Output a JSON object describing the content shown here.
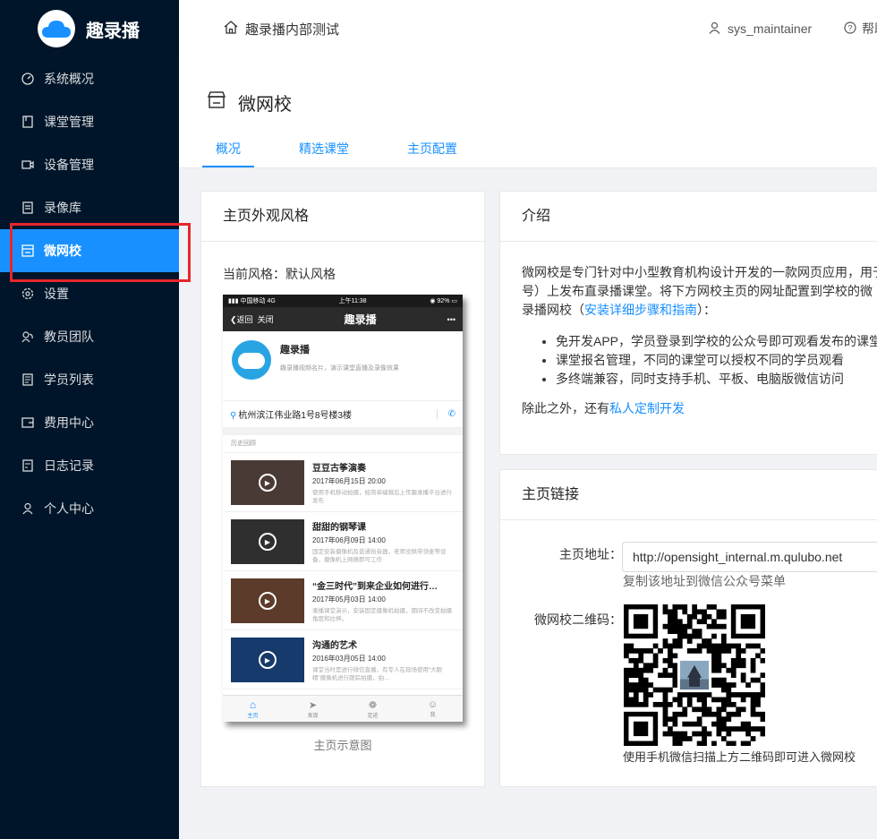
{
  "app": {
    "name": "趣录播"
  },
  "sidebar": {
    "items": [
      {
        "label": "系统概况",
        "icon": "dashboard-icon"
      },
      {
        "label": "课堂管理",
        "icon": "book-icon"
      },
      {
        "label": "设备管理",
        "icon": "video-camera-icon"
      },
      {
        "label": "录像库",
        "icon": "file-icon"
      },
      {
        "label": "微网校",
        "icon": "shop-icon"
      },
      {
        "label": "设置",
        "icon": "gear-icon"
      },
      {
        "label": "教员团队",
        "icon": "team-icon"
      },
      {
        "label": "学员列表",
        "icon": "list-icon"
      },
      {
        "label": "费用中心",
        "icon": "wallet-icon"
      },
      {
        "label": "日志记录",
        "icon": "log-icon"
      },
      {
        "label": "个人中心",
        "icon": "user-icon"
      }
    ],
    "active_index": 4
  },
  "header": {
    "breadcrumb": "趣录播内部测试",
    "username": "sys_maintainer",
    "help": "帮助"
  },
  "page": {
    "title": "微网校",
    "tabs": [
      "概况",
      "精选课堂",
      "主页配置"
    ],
    "active_tab": 0
  },
  "style_card": {
    "title": "主页外观风格",
    "current_label": "当前风格：默认风格",
    "caption": "主页示意图"
  },
  "phone": {
    "carrier": "中国移动",
    "network": "4G",
    "time": "上午11:38",
    "battery": "92%",
    "back": "返回",
    "close": "关闭",
    "title": "趣录播",
    "more": "•••",
    "school_name": "趣录播",
    "school_desc": "趣录播视频名片，演示课堂直播及录像效果",
    "address": "杭州滨江伟业路1号8号楼3楼",
    "history_label": "历史回顾",
    "courses": [
      {
        "title": "豆豆古筝演奏",
        "date": "2017年06月15日 20:00",
        "desc": "使用手机移动拍摄，经简单编辑后上传趣录播平台进行发布",
        "color": "#4a3a36"
      },
      {
        "title": "甜甜的钢琴课",
        "date": "2017年06月09日 14:00",
        "desc": "固定安装摄像机及普通拾音器，老师没佩带领麦等设备，摄像机上网络即可工作",
        "color": "#2f2f2f"
      },
      {
        "title": "“金三时代”到来企业如何进行…",
        "date": "2017年05月03日 14:00",
        "desc": "录播课堂演示，安装固定摄像机拍摄，期间不改变拍摄角度和拉伸。",
        "color": "#5c3b2a"
      },
      {
        "title": "沟通的艺术",
        "date": "2016年03月05日 14:00",
        "desc": "课堂当时是进行微信直播，有专人在现场使用“大眼精”摄像机进行跟踪拍摄，拍…",
        "color": "#153a6b"
      }
    ],
    "tabbar": [
      "主页",
      "发现",
      "足迹",
      "我"
    ]
  },
  "intro_card": {
    "title": "介绍",
    "p1": "微网校是专门针对中小型教育机构设计开发的一款网页应用，用于",
    "p2": "号）上发布直录播课堂。将下方网校主页的网址配置到学校的微",
    "p3a": "录播网校（",
    "p3link": "安装详细步骤和指南",
    "p3b": "）：",
    "bullets": [
      "免开发APP，学员登录到学校的公众号即可观看发布的课堂",
      "课堂报名管理，不同的课堂可以授权不同的学员观看",
      "多终端兼容，同时支持手机、平板、电脑版微信访问"
    ],
    "p4a": "除此之外，还有",
    "p4link": "私人定制开发"
  },
  "link_card": {
    "title": "主页链接",
    "url_label": "主页地址：",
    "url": "http://opensight_internal.m.qulubo.net",
    "url_hint": "复制该地址到微信公众号菜单",
    "qr_label": "微网校二维码：",
    "qr_hint": "使用手机微信扫描上方二维码即可进入微网校"
  }
}
